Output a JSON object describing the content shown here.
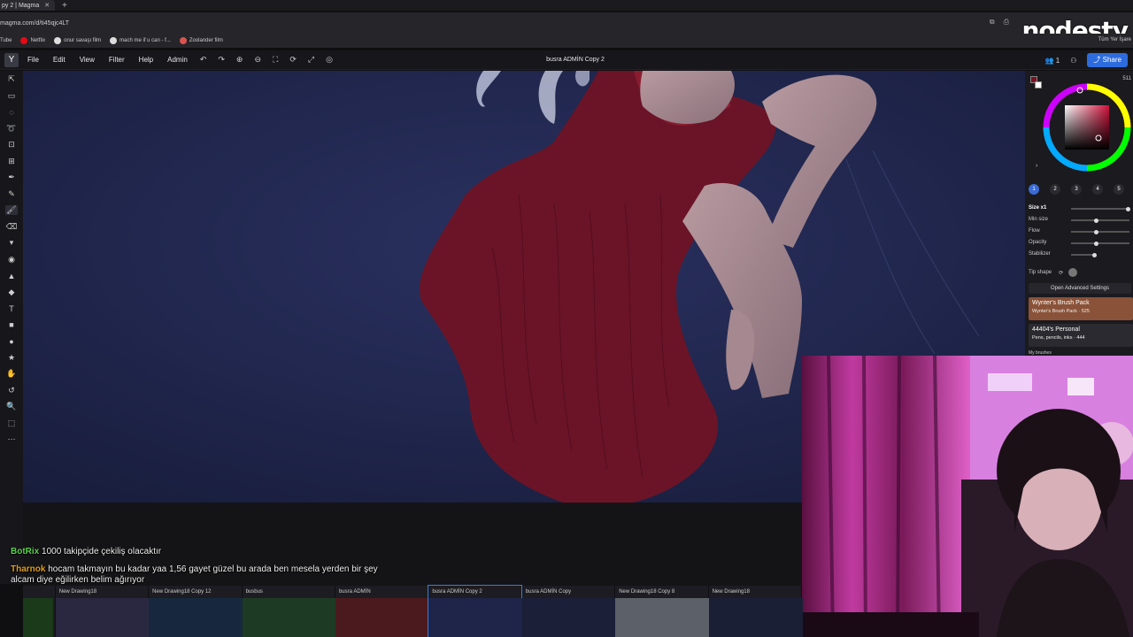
{
  "browser": {
    "tab_title": "py 2 | Magma",
    "tab_close": "✕",
    "tab_new": "+",
    "url": "magma.com/d/ti45qjc4LT",
    "watermark": "nodesty",
    "bookmarks": [
      {
        "label": "Tube",
        "color": "#333"
      },
      {
        "label": "Netflix",
        "color": "#e50914"
      },
      {
        "label": "onur savaşı film",
        "color": "#dddddd"
      },
      {
        "label": "mach me if u can - f...",
        "color": "#dddddd"
      },
      {
        "label": "Zoolander film",
        "color": "#d9534f"
      }
    ],
    "bookmarks_right": "Tüm Yer İşare"
  },
  "app": {
    "logo": "Y",
    "menu": [
      "File",
      "Edit",
      "View",
      "Filter",
      "Help",
      "Admin"
    ],
    "tool_icons": [
      "↶",
      "↷",
      "⊕",
      "⊖",
      "⛶",
      "⟳",
      "⤢",
      "◎"
    ],
    "doc_title": "busra ADMİN Copy 2",
    "user_count": "1",
    "share_label": "Share"
  },
  "left_tools": [
    "⇱",
    "▭",
    "◌",
    "➰",
    "⊡",
    "⊞",
    "✒",
    "✎",
    "🖌",
    "⌫",
    "▾",
    "◉",
    "▲",
    "◆",
    "T",
    "■",
    "●",
    "★",
    "✋",
    "↺",
    "🔍",
    "⬚",
    "⋯"
  ],
  "right_panel": {
    "size_label": "Size x1",
    "min_size_label": "Min size",
    "flow_label": "Flow",
    "opacity_label": "Opacity",
    "stabilizer_label": "Stabilizer",
    "tip_shape_label": "Tip shape",
    "counter": "511",
    "advanced_button": "Open Advanced Settings",
    "packs": [
      {
        "title": "Wynter's Brush Pack",
        "sub": "Wynter's Brush Pack · 525"
      },
      {
        "title": "44404's Personal",
        "sub": "Pens, pencils, inks · 444"
      }
    ],
    "my_brushes": "My brushes",
    "brush_slots": [
      "1",
      "2",
      "3",
      "4",
      "5"
    ],
    "colors": {
      "primary": "#7a1020",
      "secondary": "#ffffff"
    }
  },
  "chat": [
    {
      "user": "BotRix",
      "text": "1000 takipçide çekiliş olacaktır"
    },
    {
      "user": "Tharnok",
      "text": "hocam takmayın bu kadar yaa 1,56 gayet güzel bu arada ben mesela yerden bir şey"
    },
    {
      "user": "",
      "text": "alcam diye eğilirken belim ağırıyor"
    }
  ],
  "thumbnails": [
    {
      "label": "",
      "color": "#1a3a1a"
    },
    {
      "label": "New Drawing18",
      "color": "#2a2840"
    },
    {
      "label": "New Drawing18 Copy 12",
      "color": "#17283e"
    },
    {
      "label": "busbus",
      "color": "#1d3b24"
    },
    {
      "label": "busra ADMİN",
      "color": "#4a1a1e"
    },
    {
      "label": "busra ADMİN Copy 2",
      "color": "#1e2548"
    },
    {
      "label": "busra ADMİN Copy",
      "color": "#1b2038"
    },
    {
      "label": "New Drawing18 Copy 8",
      "color": "#5c6068"
    },
    {
      "label": "New Drawing18",
      "color": "#1a1f36"
    }
  ],
  "selected_thumbnail": "busra ADMİN Copy 2"
}
